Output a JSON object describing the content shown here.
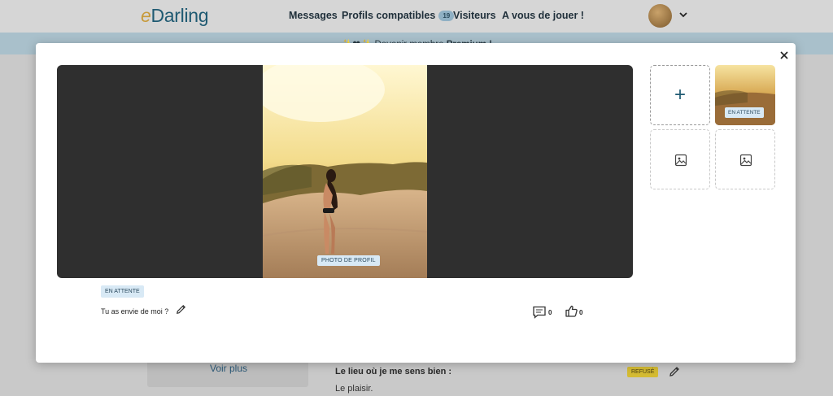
{
  "header": {
    "logo_e": "e",
    "logo_rest": "Darling",
    "nav": [
      {
        "label": "Messages"
      },
      {
        "label": "Profils compatibles",
        "badge": "19"
      },
      {
        "label": "Visiteurs"
      },
      {
        "label": "A vous de jouer !"
      }
    ]
  },
  "promo": {
    "prefix": "✨❤✨ Devenir membre ",
    "strong": "Premium !"
  },
  "background": {
    "voir_plus": "Voir plus",
    "question": "Le lieu où je me sens bien :",
    "answer": "Le plaisir.",
    "refused_badge": "REFUSÉ"
  },
  "modal": {
    "photo_label": "PHOTO DE PROFIL",
    "thumb_status": "EN ATTENTE",
    "add_symbol": "+",
    "status": "EN ATTENTE",
    "caption": "Tu as envie de moi ?",
    "comments": "0",
    "likes": "0"
  },
  "colors": {
    "brand": "#1f5a72",
    "badge_bg": "#d8e9f5",
    "refused": "#d4bb33"
  }
}
